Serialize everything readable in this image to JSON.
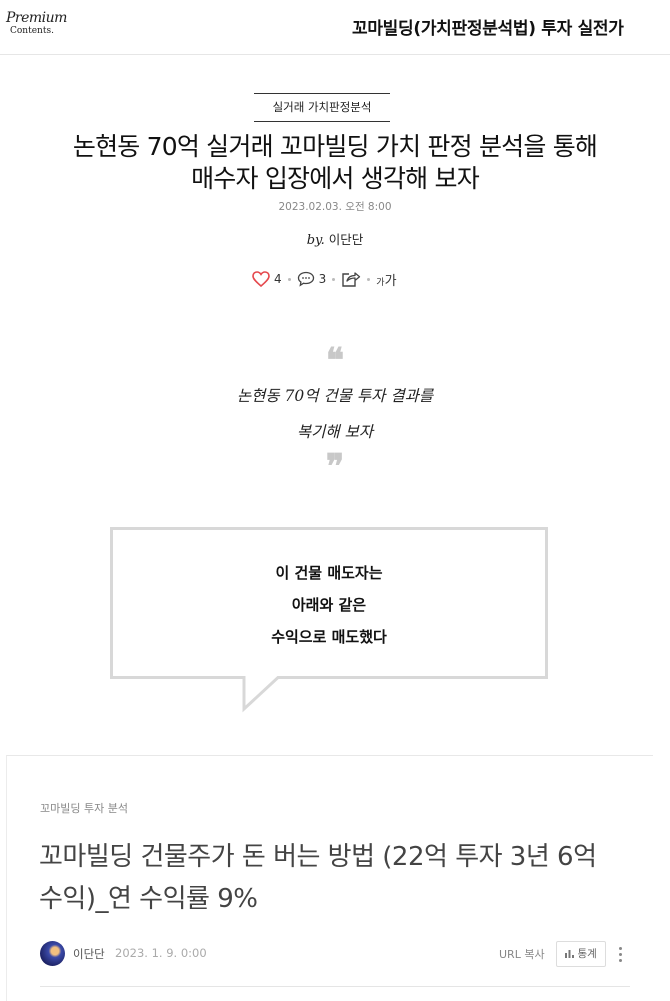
{
  "header": {
    "logo_line1": "Premium",
    "logo_line2": "Contents.",
    "title": "꼬마빌딩(가치판정분석법) 투자 실전가"
  },
  "article": {
    "category": "실거래 가치판정분석",
    "title_line1": "논현동 70억 실거래 꼬마빌딩 가치 판정 분석을 통해",
    "title_line2": "매수자 입장에서 생각해 보자",
    "date": "2023.02.03. 오전 8:00",
    "by_prefix": "by.",
    "author": "이단단",
    "likes": "4",
    "comments": "3",
    "font_small": "가",
    "font_large": "가"
  },
  "quote": {
    "open_mark": "❝",
    "line1": "논현동 70억 건물 투자 결과를",
    "line2": "복기해 보자",
    "close_mark": "❞"
  },
  "bubble": {
    "line1": "이 건물 매도자는",
    "line2": "아래와 같은",
    "line3": "수익으로 매도했다"
  },
  "card": {
    "category": "꼬마빌딩 투자 분석",
    "title_line1": "꼬마빌딩 건물주가 돈 버는 방법 (22억 투자 3년 6억",
    "title_line2": "수익)_연 수익률 9%",
    "author": "이단단",
    "date": "2023. 1. 9. 0:00",
    "url_copy": "URL 복사",
    "stats": "통계"
  },
  "colors": {
    "heart": "#e5484d",
    "text": "#111111",
    "muted": "#888888"
  }
}
